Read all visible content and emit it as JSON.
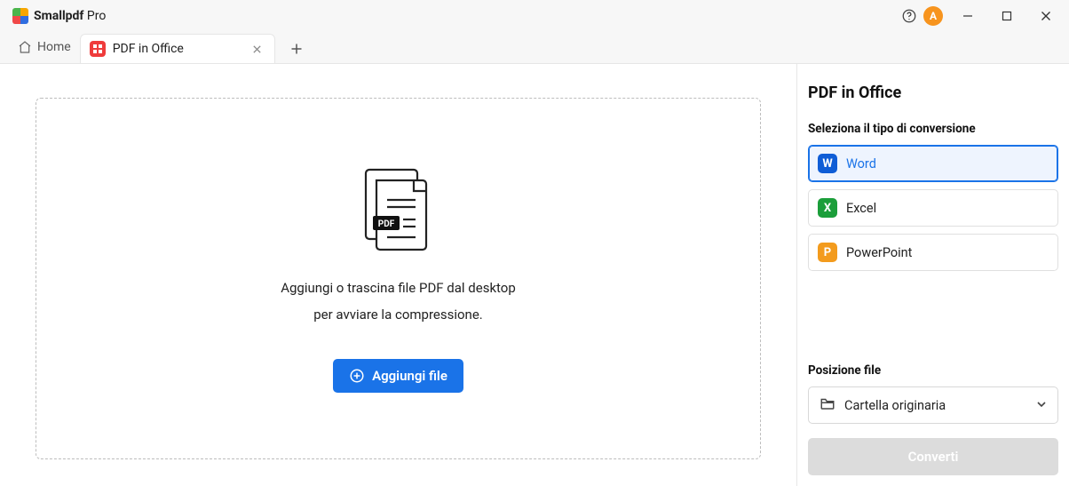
{
  "titlebar": {
    "app_name_strong": "Smallpdf",
    "app_name_suffix": " Pro",
    "avatar_letter": "A"
  },
  "tabs": {
    "home_label": "Home",
    "active_tab_label": "PDF in Office"
  },
  "dropzone": {
    "line1": "Aggiungi o trascina file PDF dal desktop",
    "line2": "per avviare la compressione.",
    "add_button": "Aggiungi file"
  },
  "side": {
    "title": "PDF in Office",
    "type_label": "Seleziona il tipo di conversione",
    "options": {
      "word": "Word",
      "excel": "Excel",
      "powerpoint": "PowerPoint"
    },
    "position_label": "Posizione file",
    "position_value": "Cartella originaria",
    "convert": "Converti"
  }
}
